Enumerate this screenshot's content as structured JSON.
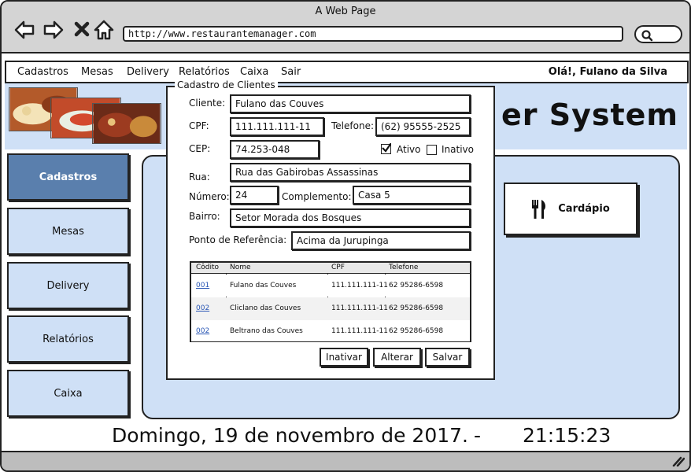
{
  "window": {
    "title": "A Web Page",
    "url": "http://www.restaurantemanager.com"
  },
  "nav_icons": [
    "back-arrow-icon",
    "forward-arrow-icon",
    "close-x-icon",
    "home-icon",
    "search-icon"
  ],
  "menu": {
    "items": [
      "Cadastros",
      "Mesas",
      "Delivery",
      "Relatórios",
      "Caixa",
      "Sair"
    ],
    "greeting": "Olá!, Fulano da Silva"
  },
  "banner": {
    "title_fragment": "er System"
  },
  "sidebar": {
    "items": [
      "Cadastros",
      "Mesas",
      "Delivery",
      "Relatórios",
      "Caixa"
    ],
    "active": "Cadastros"
  },
  "content": {
    "cardapio_label": "Cardápio",
    "cardapio_icon": "fork-knife-icon"
  },
  "form": {
    "legend": "Cadastro de Clientes",
    "cliente_label": "Cliente:",
    "cliente_value": "Fulano das Couves",
    "cpf_label": "CPF:",
    "cpf_value": "111.111.111-11",
    "telefone_label": "Telefone:",
    "telefone_value": "(62) 95555-2525",
    "cep_label": "CEP:",
    "cep_value": "74.253-048",
    "ativo_label": "Ativo",
    "ativo_checked": true,
    "inativo_label": "Inativo",
    "inativo_checked": false,
    "rua_label": "Rua:",
    "rua_value": "Rua das Gabirobas Assassinas",
    "numero_label": "Número:",
    "numero_value": "24",
    "complemento_label": "Complemento:",
    "complemento_value": "Casa 5",
    "bairro_label": "Bairro:",
    "bairro_value": "Setor Morada dos Bosques",
    "referencia_label": "Ponto de Referência:",
    "referencia_value": "Acima da Jurupinga"
  },
  "table": {
    "headers": [
      "Côdito",
      "Nome",
      "CPF",
      "Telefone"
    ],
    "rows": [
      [
        "001",
        "Fulano das Couves",
        "111.111.111-11",
        "62 95286-6598"
      ],
      [
        "002",
        "Cliclano das Couves",
        "111.111.111-11",
        "62 95286-6598"
      ],
      [
        "002",
        "Beltrano das Couves",
        "111.111.111-11",
        "62 95286-6598"
      ]
    ]
  },
  "buttons": {
    "inativar": "Inativar",
    "alterar": "Alterar",
    "salvar": "Salvar"
  },
  "footer": {
    "date": "Domingo, 19 de novembro de 2017.",
    "separator": "-",
    "time": "21:15:23"
  },
  "colors": {
    "panel_blue": "#cfe0f6",
    "active_blue": "#5a7fad",
    "link_blue": "#2a57b5",
    "chrome_gray": "#d4d4d4"
  }
}
